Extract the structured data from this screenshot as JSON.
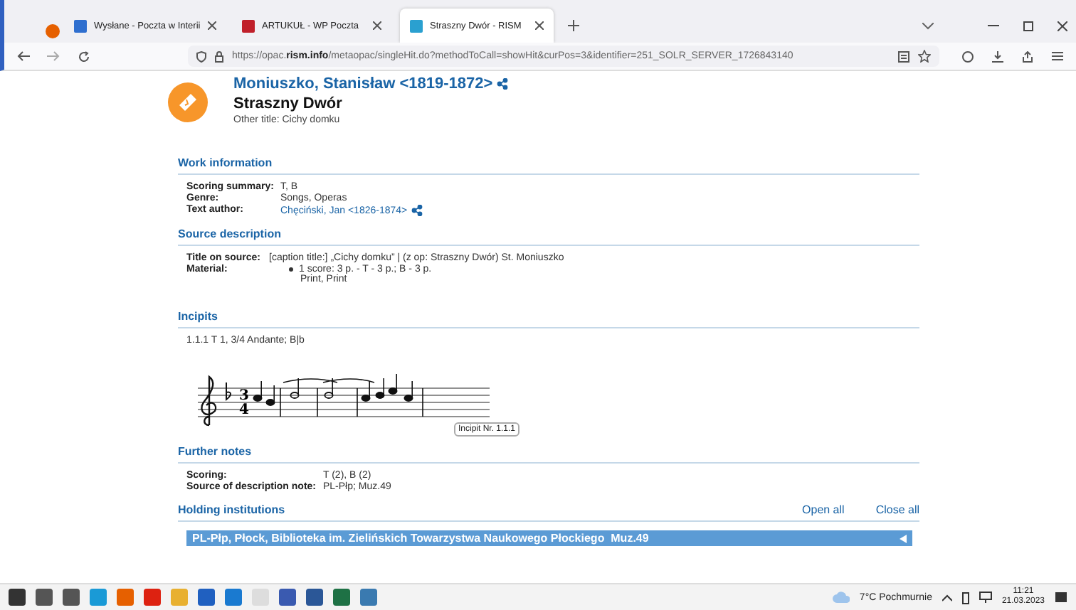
{
  "browser": {
    "tabs": [
      {
        "title": "Wysłane - Poczta w Interii",
        "selected": false
      },
      {
        "title": "ARTUKUŁ - WP Poczta",
        "selected": false
      },
      {
        "title": "Straszny Dwór - RISM",
        "selected": true
      }
    ],
    "url": {
      "prefix": "https://opac.",
      "domain": "rism.info",
      "rest": "/metaopac/singleHit.do?methodToCall=showHit&curPos=3&identifier=251_SOLR_SERVER_1726843140"
    }
  },
  "record": {
    "composer": "Moniuszko, Stanisław <1819-1872>",
    "title": "Straszny Dwór",
    "other_title": "Other title: Cichy domku"
  },
  "sections": [
    {
      "heading": "Work information",
      "fields": [
        {
          "label": "Scoring summary:",
          "value": "T, B",
          "kind": "text"
        },
        {
          "label": "Genre:",
          "value": "Songs, Operas",
          "kind": "text"
        },
        {
          "label": "Text author:",
          "value": "Chęciński, Jan <1826-1874>",
          "kind": "link"
        }
      ]
    },
    {
      "heading": "Source description",
      "fields": [
        {
          "label": "Title on source:",
          "value": "[caption title:] „Cichy domku” | (z op: Straszny Dwór) St. Moniuszko",
          "kind": "text"
        },
        {
          "label": "Material:",
          "value": "1 score: 3 p. - T - 3 p.; B - 3 p.",
          "extra": "Print, Print",
          "kind": "bullet"
        }
      ]
    }
  ],
  "incipits": {
    "heading": "Incipits",
    "caption": "1.1.1 T 1, 3/4 Andante; B|b",
    "time_signature": [
      "3",
      "4"
    ],
    "tooltip": "Incipit Nr. 1.1.1"
  },
  "further_notes": {
    "heading": "Further notes",
    "fields": [
      {
        "label": "Scoring:",
        "value": "T (2), B (2)"
      },
      {
        "label": "Source of description note:",
        "value": "PL-Płp; Muz.49"
      }
    ]
  },
  "holdings": {
    "heading": "Holding institutions",
    "open_all": "Open all",
    "close_all": "Close all",
    "items": [
      {
        "name": "PL-Płp, Płock, Biblioteka im. Zielińskich Towarzystwa Naukowego Płockiego  Muz.49",
        "expanded": false
      }
    ]
  },
  "taskbar": {
    "weather": "7°C  Pochmurnie",
    "time": "11:21",
    "date": "21.03.2023"
  }
}
